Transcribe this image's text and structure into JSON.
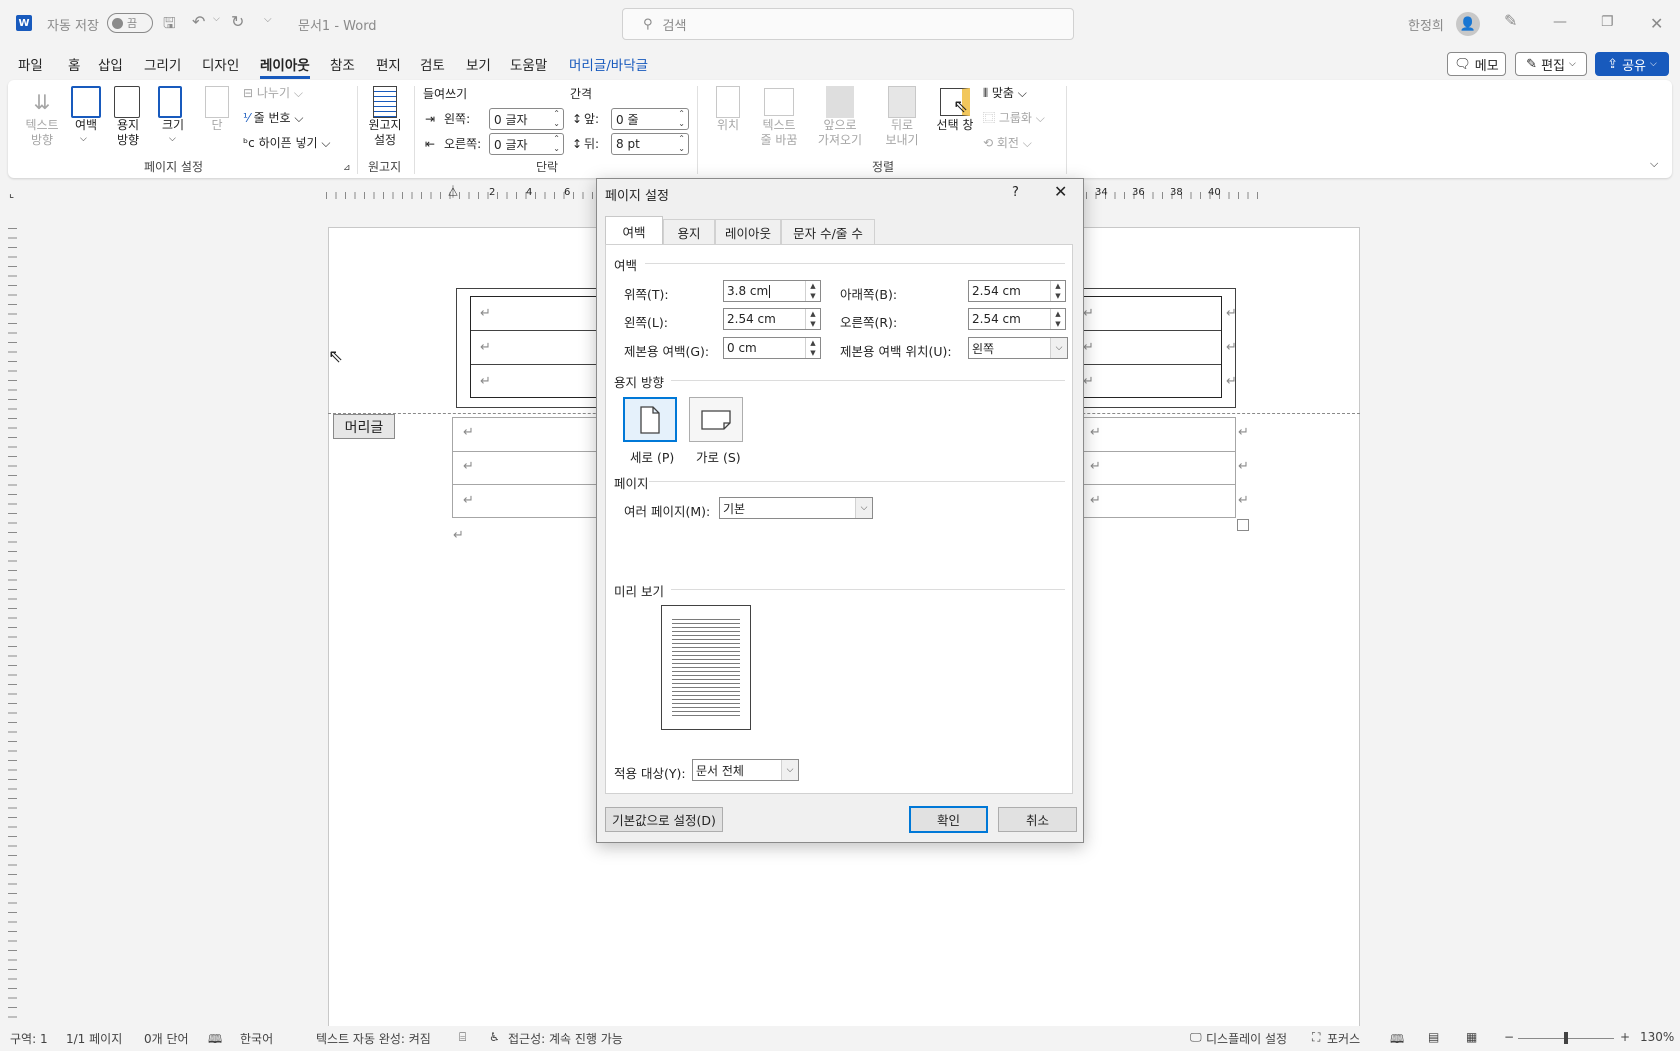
{
  "titlebar": {
    "autosave_label": "자동 저장",
    "autosave_state": "끔",
    "doc_title": "문서1  -  Word",
    "search_placeholder": "검색",
    "user_name": "한정희"
  },
  "menu": {
    "tabs": [
      "파일",
      "홈",
      "삽입",
      "그리기",
      "디자인",
      "레이아웃",
      "참조",
      "편지",
      "검토",
      "보기",
      "도움말",
      "머리글/바닥글"
    ],
    "memo_label": "메모",
    "edit_label": "편집",
    "share_label": "공유"
  },
  "ribbon": {
    "page_setup": {
      "text_direction": "텍스트\n방향",
      "margins": "여백",
      "orientation": "용지\n방향",
      "size": "크기",
      "columns": "단",
      "breaks": "나누기",
      "line_numbers": "줄 번호",
      "hyphenation": "하이픈 넣기",
      "group_label": "페이지 설정"
    },
    "manuscript": {
      "label": "원고지\n설정",
      "group_label": "원고지"
    },
    "paragraph": {
      "indent_header": "들여쓰기",
      "spacing_header": "간격",
      "left_label": "왼쪽:",
      "right_label": "오른쪽:",
      "before_label": "앞:",
      "after_label": "뒤:",
      "left_value": "0 글자",
      "right_value": "0 글자",
      "before_value": "0 줄",
      "after_value": "8 pt",
      "group_label": "단락"
    },
    "arrange": {
      "position": "위치",
      "wrap_text": "텍스트\n줄 바꿈",
      "bring_forward": "앞으로\n가져오기",
      "send_backward": "뒤로\n보내기",
      "selection_pane": "선택 창",
      "align": "맞춤",
      "group": "그룹화",
      "rotate": "회전",
      "group_label": "정렬"
    }
  },
  "ruler": {
    "ticks": [
      "2",
      "4",
      "6",
      "34",
      "36",
      "38",
      "40"
    ]
  },
  "document": {
    "header_tag": "머리글",
    "para_mark": "↵"
  },
  "dialog": {
    "title": "페이지 설정",
    "help": "?",
    "tabs": [
      "여백",
      "용지",
      "레이아웃",
      "문자 수/줄 수"
    ],
    "margins_section": "여백",
    "top_label": "위쪽(T):",
    "top_value": "3.8 cm",
    "bottom_label": "아래쪽(B):",
    "bottom_value": "2.54 cm",
    "left_label": "왼쪽(L):",
    "left_value": "2.54 cm",
    "right_label": "오른쪽(R):",
    "right_value": "2.54 cm",
    "gutter_label": "제본용 여백(G):",
    "gutter_value": "0 cm",
    "gutter_pos_label": "제본용 여백 위치(U):",
    "gutter_pos_value": "왼쪽",
    "orientation_section": "용지 방향",
    "portrait_label": "세로 (P)",
    "landscape_label": "가로 (S)",
    "pages_section": "페이지",
    "multiple_pages_label": "여러 페이지(M):",
    "multiple_pages_value": "기본",
    "preview_section": "미리 보기",
    "apply_to_label": "적용 대상(Y):",
    "apply_to_value": "문서 전체",
    "set_default": "기본값으로 설정(D)",
    "ok": "확인",
    "cancel": "취소"
  },
  "status": {
    "section": "구역: 1",
    "page": "1/1 페이지",
    "words": "0개 단어",
    "language": "한국어",
    "autocomplete": "텍스트 자동 완성: 켜짐",
    "accessibility": "접근성: 계속 진행 가능",
    "display_settings": "디스플레이 설정",
    "focus": "포커스",
    "zoom": "130%"
  },
  "colors": {
    "accent": "#185abd",
    "dialog_focus": "#0078d7",
    "selection_pane_icon": "#f2c75c"
  }
}
